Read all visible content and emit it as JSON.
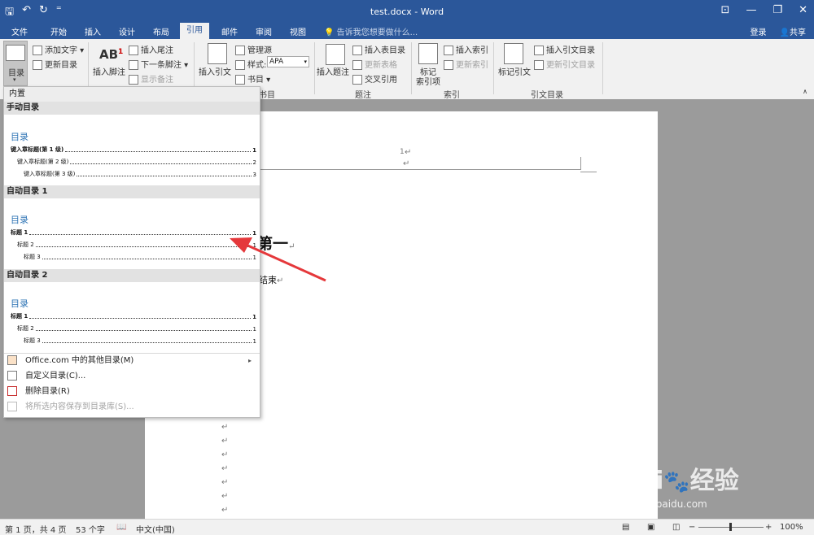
{
  "window": {
    "title": "test.docx - Word"
  },
  "qat": {
    "save_icon": "save-icon",
    "undo_icon": "undo-icon",
    "redo_icon": "redo-icon",
    "customize": "⁼"
  },
  "tabs": [
    {
      "label": "文件"
    },
    {
      "label": "开始"
    },
    {
      "label": "插入"
    },
    {
      "label": "设计"
    },
    {
      "label": "布局"
    },
    {
      "label": "引用",
      "active": true
    },
    {
      "label": "邮件"
    },
    {
      "label": "审阅"
    },
    {
      "label": "视图"
    }
  ],
  "tellme": "告诉我您想要做什么...",
  "account": {
    "signin": "登录",
    "share": "共享"
  },
  "ribbon": {
    "toc": {
      "label": "目录",
      "add_text": "添加文字",
      "update": "更新目录"
    },
    "footnotes": {
      "insert_footnote_big": "插入脚注",
      "insert_endnote": "插入尾注",
      "next_footnote": "下一条脚注",
      "show_notes": "显示备注"
    },
    "citations": {
      "insert_citation": "插入引文",
      "manage_sources": "管理源",
      "style_label": "样式:",
      "style_value": "APA",
      "bibliography": "书目",
      "group_label": "书目"
    },
    "captions": {
      "insert_caption": "插入题注",
      "insert_table_of_figures": "插入表目录",
      "update_table": "更新表格",
      "cross_reference": "交叉引用",
      "group_label": "题注"
    },
    "index": {
      "mark_entry": "标记",
      "mark_entry_2": "索引项",
      "insert_index": "插入索引",
      "update_index": "更新索引",
      "group_label": "索引"
    },
    "toa": {
      "mark_citation": "标记引文",
      "insert_toa": "插入引文目录",
      "update_toa": "更新引文目录",
      "group_label": "引文目录"
    }
  },
  "dropdown": {
    "builtin": "内置",
    "manual": {
      "name": "手动目录",
      "title": "目录",
      "rows": [
        {
          "label": "键入章标题(第 1 级)",
          "page": "1"
        },
        {
          "label": "键入章标题(第 2 级)",
          "page": "2"
        },
        {
          "label": "键入章标题(第 3 级)",
          "page": "3"
        }
      ]
    },
    "auto1": {
      "name": "自动目录 1",
      "title": "目录",
      "rows": [
        {
          "label": "标题 1",
          "page": "1"
        },
        {
          "label": "标题 2",
          "page": "1"
        },
        {
          "label": "标题 3",
          "page": "1"
        }
      ]
    },
    "auto2": {
      "name": "自动目录 2",
      "title": "目录",
      "rows": [
        {
          "label": "标题 1",
          "page": "1"
        },
        {
          "label": "标题 2",
          "page": "1"
        },
        {
          "label": "标题 3",
          "page": "1"
        }
      ]
    },
    "menu": [
      {
        "label": "Office.com 中的其他目录(M)",
        "icon": "office-toc-icon"
      },
      {
        "label": "自定义目录(C)...",
        "icon": "custom-toc-icon"
      },
      {
        "label": "删除目录(R)",
        "icon": "remove-toc-icon"
      },
      {
        "label": "将所选内容保存到目录库(S)...",
        "icon": "save-to-gallery-icon",
        "disabled": true
      }
    ]
  },
  "document": {
    "header_page_number": "1",
    "heading": "第一",
    "body_text": "结束"
  },
  "status": {
    "page": "第 1 页，共 4 页",
    "words": "53 个字",
    "language": "中文(中国)",
    "zoom": "100%"
  },
  "watermark": {
    "url": "jingyan.baidu.com"
  },
  "colors": {
    "word_blue": "#2b579a",
    "toc_blue": "#2e74b5",
    "arrow_red": "#e5383b"
  }
}
